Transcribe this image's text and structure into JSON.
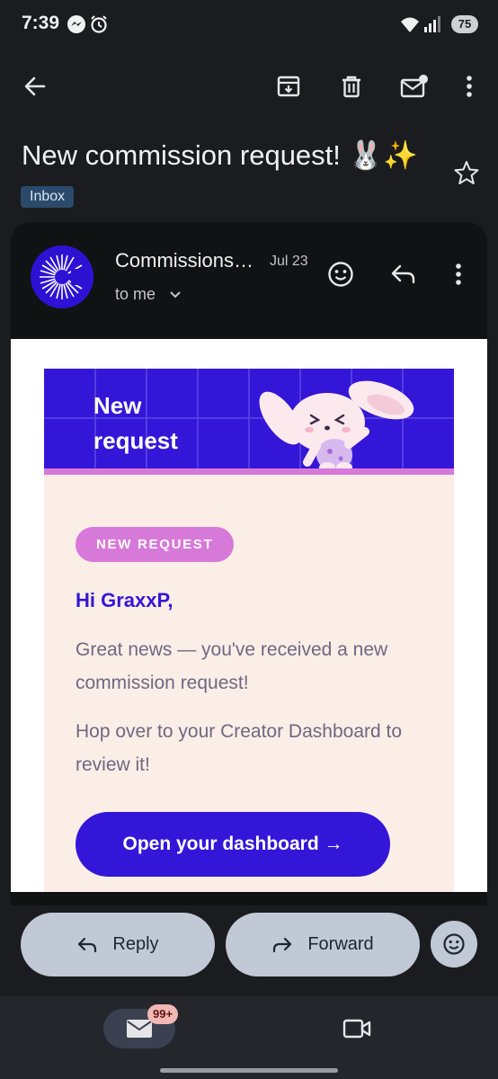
{
  "status_bar": {
    "time": "7:39",
    "battery": "75"
  },
  "email": {
    "subject": "New commission request! 🐰✨",
    "label": "Inbox",
    "sender": "Commissions…",
    "date": "Jul 23",
    "recipient": "to me"
  },
  "content": {
    "banner_title": "New request",
    "badge": "NEW REQUEST",
    "greeting": "Hi GraxxP,",
    "paragraph1": "Great news — you've received a new commission request!",
    "paragraph2": "Hop over to your Creator Dashboard to review it!",
    "cta_label": "Open your dashboard →"
  },
  "actions": {
    "reply": "Reply",
    "forward": "Forward"
  },
  "nav": {
    "mail_count": "99+"
  },
  "colors": {
    "brand": "#3416d8",
    "accent_pink": "#d779d9",
    "email_bg": "#fbeee6",
    "app_bg": "#1b1c1f"
  }
}
